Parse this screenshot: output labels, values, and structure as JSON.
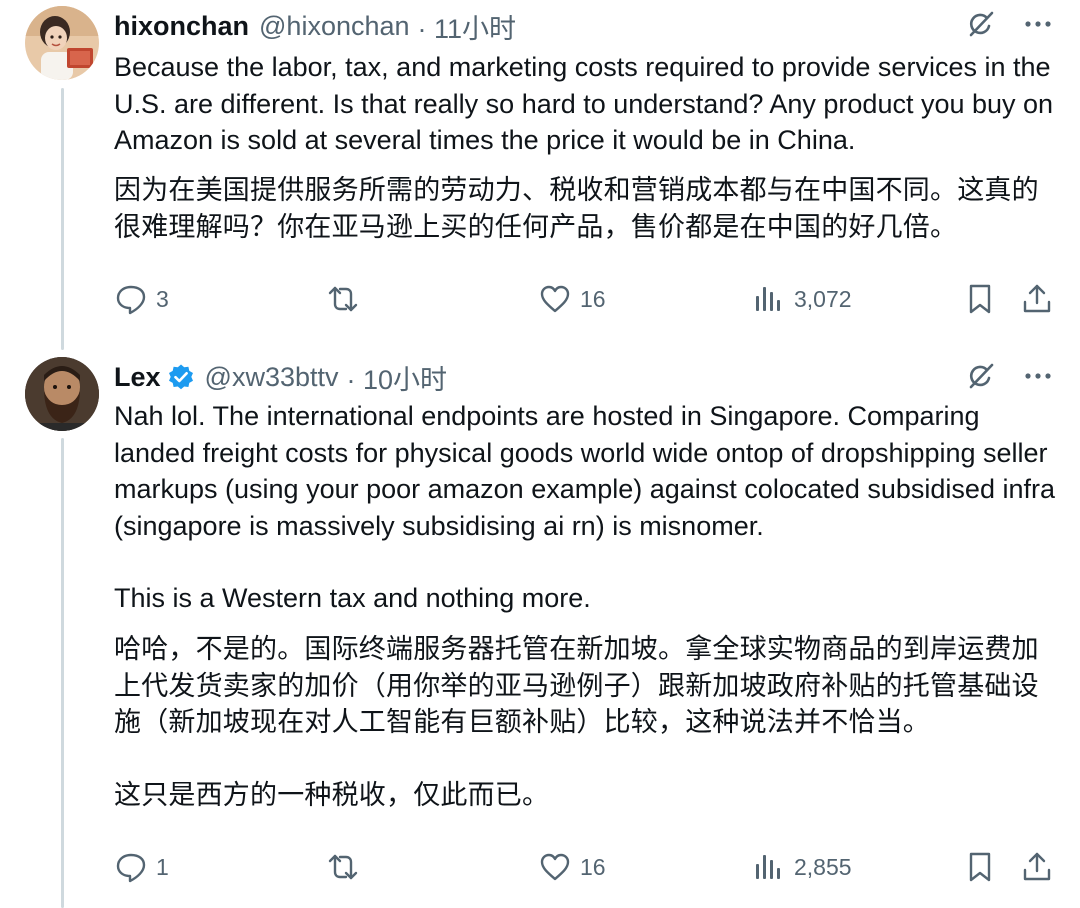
{
  "tweets": [
    {
      "author_name": "hixonchan",
      "author_handle": "@hixonchan",
      "time": "· 11小时",
      "verified": false,
      "text_en": "Because the labor, tax, and marketing costs required to provide services in the U.S. are different. Is that really so hard to understand? Any product you buy on Amazon is sold at several times the price it would be in China.",
      "text_cn": "因为在美国提供服务所需的劳动力、税收和营销成本都与在中国不同。这真的很难理解吗？你在亚马逊上买的任何产品，售价都是在中国的好几倍。",
      "replies": "3",
      "retweets": "",
      "likes": "16",
      "views": "3,072"
    },
    {
      "author_name": "Lex",
      "author_handle": "@xw33bttv",
      "time": "· 10小时",
      "verified": true,
      "text_en_1": "Nah lol. The international endpoints are hosted in Singapore. Comparing landed freight costs for physical goods world wide ontop of dropshipping seller markups (using your poor amazon example) against colocated subsidised infra (singapore is massively subsidising ai rn) is misnomer.",
      "text_en_2": "This is a Western tax and nothing more.",
      "text_cn_1": "哈哈，不是的。国际终端服务器托管在新加坡。拿全球实物商品的到岸运费加上代发货卖家的加价（用你举的亚马逊例子）跟新加坡政府补贴的托管基础设施（新加坡现在对人工智能有巨额补贴）比较，这种说法并不恰当。",
      "text_cn_2": "这只是西方的一种税收，仅此而已。",
      "replies": "1",
      "retweets": "",
      "likes": "16",
      "views": "2,855"
    }
  ],
  "icons": {
    "grok": "grok-icon",
    "more": "more-icon",
    "reply": "reply-icon",
    "retweet": "retweet-icon",
    "like": "like-icon",
    "views": "views-icon",
    "bookmark": "bookmark-icon",
    "share": "share-icon"
  },
  "colors": {
    "text": "#0f1419",
    "secondary": "#536471",
    "verified": "#1d9bf0",
    "thread_line": "#cfd9de"
  }
}
